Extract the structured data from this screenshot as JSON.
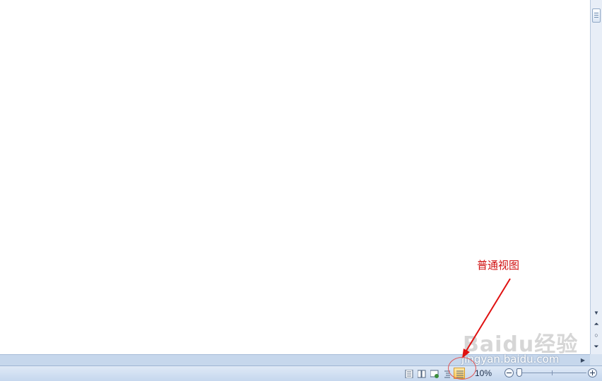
{
  "annotation": {
    "label": "普通视图"
  },
  "statusbar": {
    "zoom_percent": "10%",
    "views": [
      {
        "name": "page-layout-view"
      },
      {
        "name": "full-screen-reading-view"
      },
      {
        "name": "web-layout-view"
      },
      {
        "name": "outline-view"
      },
      {
        "name": "draft-view",
        "active": true
      }
    ],
    "zoom_slider_level": 0.1
  },
  "watermark": {
    "logo": "Baidu经验",
    "url": "jingyan.baidu.com"
  },
  "colors": {
    "annotation": "#d01010",
    "active_view": "#ffc95a",
    "statusbar": "#c5d7ee"
  }
}
